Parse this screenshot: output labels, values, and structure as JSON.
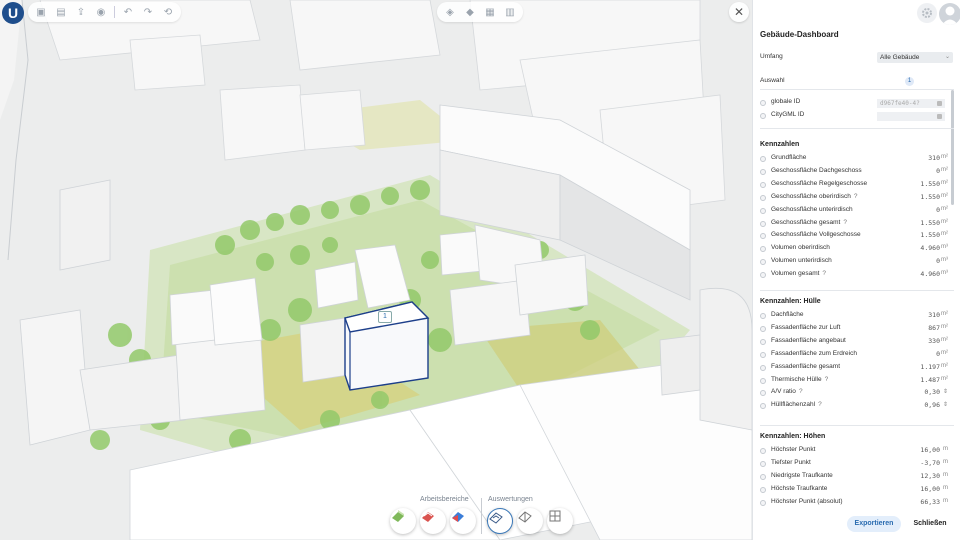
{
  "toolbar": {
    "left_icons": [
      "floppy-icon",
      "save-as-icon",
      "upload-icon",
      "camera-icon",
      "undo-icon",
      "redo-icon",
      "history-icon"
    ],
    "center_icons": [
      "layers-icon",
      "cube-icon",
      "camera-view-icon",
      "grid-icon"
    ]
  },
  "logo": {
    "text": "U"
  },
  "scene": {
    "selected_badge": "1"
  },
  "bottom": {
    "arbeitsbereiche_label": "Arbeitsbereiche",
    "auswertungen_label": "Auswertungen"
  },
  "panel": {
    "title": "Gebäude-Dashboard",
    "umfang_label": "Umfang",
    "umfang_value": "Alle Gebäude",
    "auswahl_label": "Auswahl",
    "auswahl_count": "1",
    "ids": [
      {
        "label": "globale ID",
        "value": "d967fe40-4?"
      },
      {
        "label": "CityGML ID",
        "value": ""
      }
    ],
    "sections": [
      {
        "title": "Kennzahlen",
        "rows": [
          {
            "label": "Grundfläche",
            "help": false,
            "value": "310",
            "unit": "m²"
          },
          {
            "label": "Geschossfläche Dachgeschoss",
            "help": false,
            "value": "0",
            "unit": "m²"
          },
          {
            "label": "Geschossfläche Regelgeschosse",
            "help": false,
            "value": "1.550",
            "unit": "m²"
          },
          {
            "label": "Geschossfläche oberirdisch",
            "help": true,
            "value": "1.550",
            "unit": "m²"
          },
          {
            "label": "Geschossfläche unterirdisch",
            "help": false,
            "value": "0",
            "unit": "m²"
          },
          {
            "label": "Geschossfläche gesamt",
            "help": true,
            "value": "1.550",
            "unit": "m²"
          },
          {
            "label": "Geschossfläche Vollgeschosse",
            "help": false,
            "value": "1.550",
            "unit": "m²"
          },
          {
            "label": "Volumen oberirdisch",
            "help": false,
            "value": "4.960",
            "unit": "m³"
          },
          {
            "label": "Volumen unterirdisch",
            "help": false,
            "value": "0",
            "unit": "m³"
          },
          {
            "label": "Volumen gesamt",
            "help": true,
            "value": "4.960",
            "unit": "m³"
          }
        ]
      },
      {
        "title": "Kennzahlen: Hülle",
        "rows": [
          {
            "label": "Dachfläche",
            "help": false,
            "value": "310",
            "unit": "m²"
          },
          {
            "label": "Fassadenfläche zur Luft",
            "help": false,
            "value": "867",
            "unit": "m²"
          },
          {
            "label": "Fassadenfläche angebaut",
            "help": false,
            "value": "330",
            "unit": "m²"
          },
          {
            "label": "Fassadenfläche zum Erdreich",
            "help": false,
            "value": "0",
            "unit": "m²"
          },
          {
            "label": "Fassadenfläche gesamt",
            "help": false,
            "value": "1.197",
            "unit": "m²"
          },
          {
            "label": "Thermische Hülle",
            "help": true,
            "value": "1.487",
            "unit": "m²"
          },
          {
            "label": "A/V ratio",
            "help": true,
            "value": "0,30",
            "unit": ""
          },
          {
            "label": "Hüllflächenzahl",
            "help": true,
            "value": "0,96",
            "unit": ""
          }
        ]
      },
      {
        "title": "Kennzahlen: Höhen",
        "rows": [
          {
            "label": "Höchster Punkt",
            "help": false,
            "value": "16,00",
            "unit": "m"
          },
          {
            "label": "Tiefster Punkt",
            "help": false,
            "value": "-3,70",
            "unit": "m"
          },
          {
            "label": "Niedrigste Traufkante",
            "help": false,
            "value": "12,30",
            "unit": "m"
          },
          {
            "label": "Höchste Traufkante",
            "help": false,
            "value": "16,00",
            "unit": "m"
          },
          {
            "label": "Höchster Punkt (absolut)",
            "help": false,
            "value": "66,33",
            "unit": "m"
          }
        ]
      }
    ],
    "export_label": "Exportieren",
    "close_label": "Schließen"
  }
}
